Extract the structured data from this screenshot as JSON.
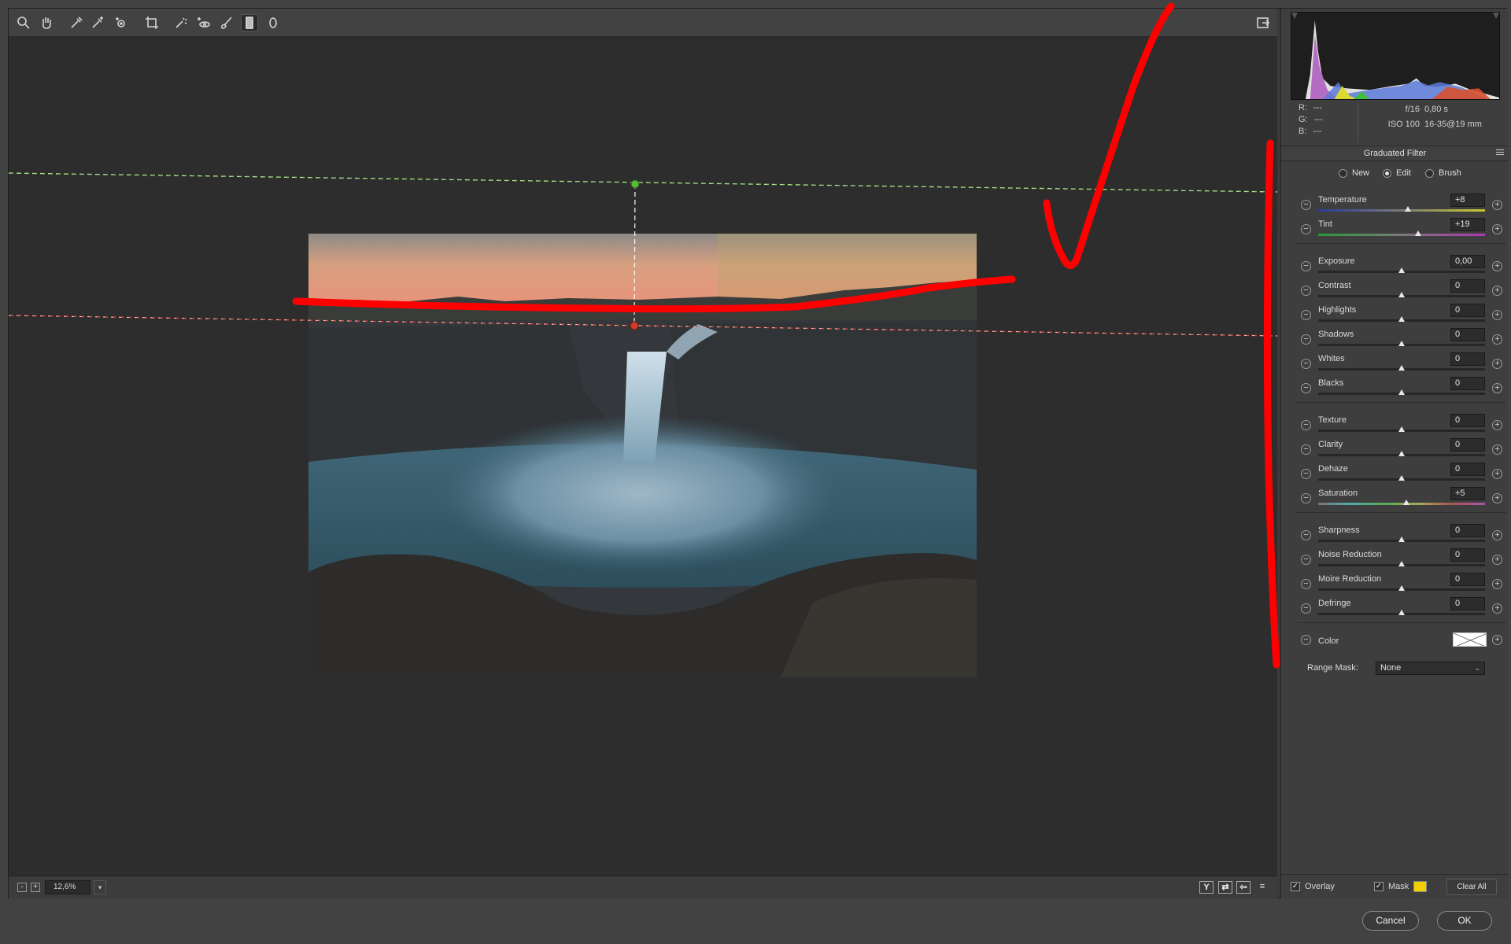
{
  "toolbar": {
    "tools": [
      "zoom-tool-icon",
      "hand-tool-icon",
      "white-balance-icon",
      "color-sampler-icon",
      "targeted-adjustment-icon",
      "crop-icon",
      "spot-removal-icon",
      "red-eye-icon",
      "adjustment-brush-icon",
      "graduated-filter-icon",
      "radial-filter-icon"
    ],
    "fullscreen_icon": "fullscreen-toggle-icon"
  },
  "status": {
    "zoom_value": "12,6%",
    "zoom_out": "-",
    "zoom_in": "+",
    "view_buttons": [
      "Y",
      "⇄",
      "⇦",
      "≡"
    ]
  },
  "info": {
    "r_label": "R:",
    "r_value": "---",
    "g_label": "G:",
    "g_value": "---",
    "b_label": "B:",
    "b_value": "---",
    "aperture": "f/16",
    "shutter": "0,80 s",
    "iso": "ISO 100",
    "lens": "16-35@19 mm"
  },
  "panel": {
    "title": "Graduated Filter",
    "modes": [
      {
        "label": "New",
        "selected": false
      },
      {
        "label": "Edit",
        "selected": true
      },
      {
        "label": "Brush",
        "selected": false
      }
    ],
    "sliders": [
      {
        "label": "Temperature",
        "value": "+8",
        "pos": 0.54,
        "track": "temp"
      },
      {
        "label": "Tint",
        "value": "+19",
        "pos": 0.6,
        "track": "tint"
      },
      {
        "label": "Exposure",
        "value": "0,00",
        "pos": 0.5,
        "track": ""
      },
      {
        "label": "Contrast",
        "value": "0",
        "pos": 0.5,
        "track": ""
      },
      {
        "label": "Highlights",
        "value": "0",
        "pos": 0.5,
        "track": ""
      },
      {
        "label": "Shadows",
        "value": "0",
        "pos": 0.5,
        "track": ""
      },
      {
        "label": "Whites",
        "value": "0",
        "pos": 0.5,
        "track": ""
      },
      {
        "label": "Blacks",
        "value": "0",
        "pos": 0.5,
        "track": ""
      },
      {
        "label": "Texture",
        "value": "0",
        "pos": 0.5,
        "track": ""
      },
      {
        "label": "Clarity",
        "value": "0",
        "pos": 0.5,
        "track": ""
      },
      {
        "label": "Dehaze",
        "value": "0",
        "pos": 0.5,
        "track": ""
      },
      {
        "label": "Saturation",
        "value": "+5",
        "pos": 0.53,
        "track": "sat"
      },
      {
        "label": "Sharpness",
        "value": "0",
        "pos": 0.5,
        "track": ""
      },
      {
        "label": "Noise Reduction",
        "value": "0",
        "pos": 0.5,
        "track": ""
      },
      {
        "label": "Moire Reduction",
        "value": "0",
        "pos": 0.5,
        "track": ""
      },
      {
        "label": "Defringe",
        "value": "0",
        "pos": 0.5,
        "track": ""
      }
    ],
    "color_label": "Color",
    "range_mask_label": "Range Mask:",
    "range_mask_value": "None",
    "overlay_label": "Overlay",
    "overlay_checked": true,
    "mask_label": "Mask",
    "mask_checked": true,
    "mask_color": "#f2d000",
    "clear_all_label": "Clear All"
  },
  "dialog": {
    "cancel_label": "Cancel",
    "ok_label": "OK"
  },
  "colors": {
    "annotation": "#ff0000",
    "guide_green": "#7ecb5a",
    "guide_red": "#e05040"
  }
}
